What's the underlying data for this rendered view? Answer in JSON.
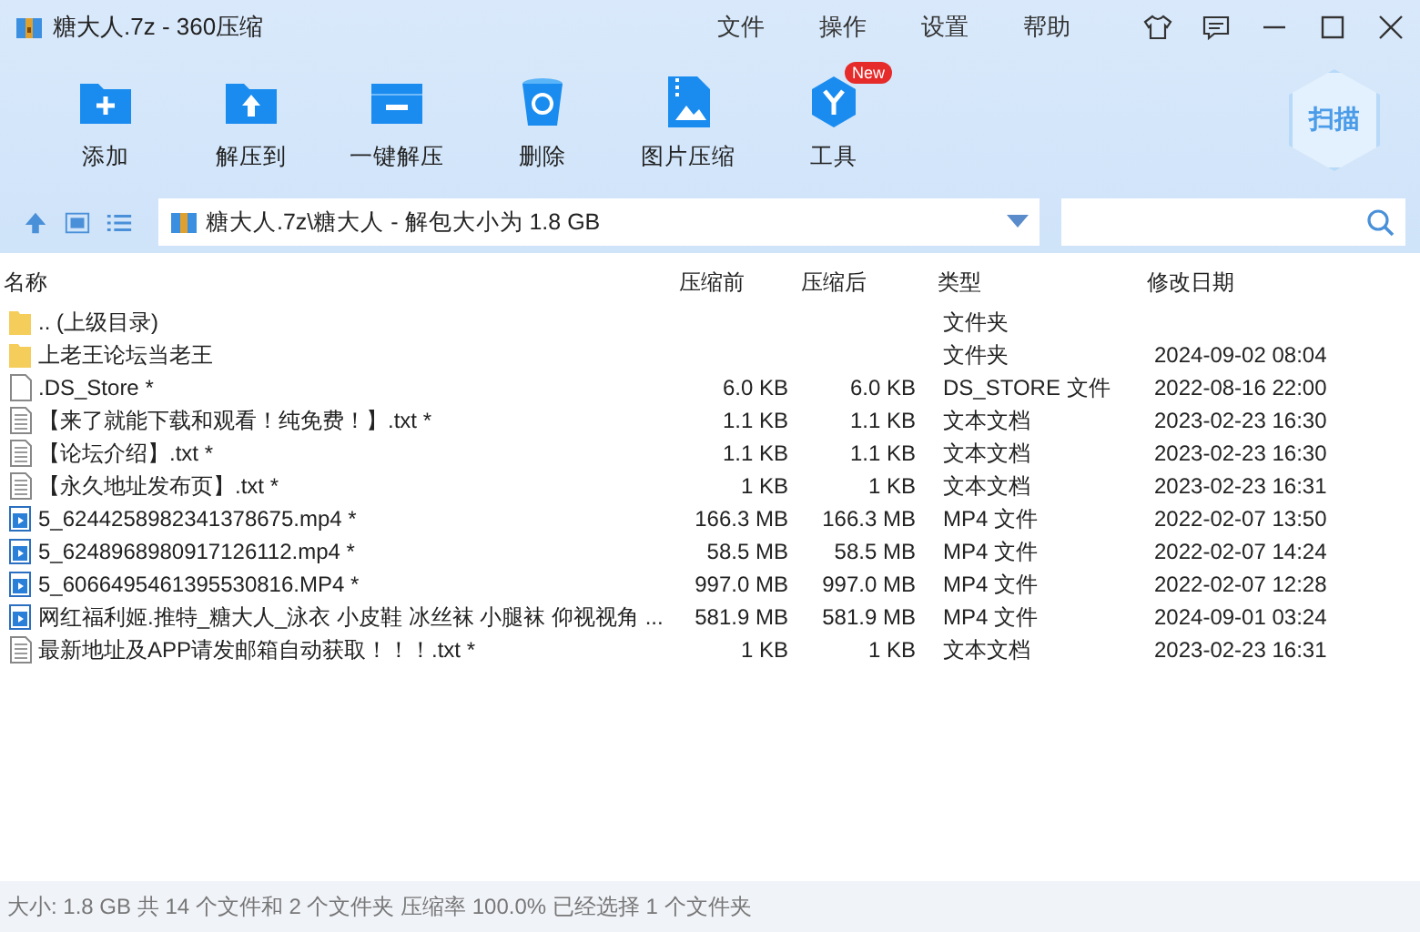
{
  "window": {
    "title": "糖大人.7z - 360压缩"
  },
  "menu": [
    "文件",
    "操作",
    "设置",
    "帮助"
  ],
  "toolbar": [
    {
      "label": "添加",
      "kind": "add"
    },
    {
      "label": "解压到",
      "kind": "extract"
    },
    {
      "label": "一键解压",
      "kind": "oneclick"
    },
    {
      "label": "删除",
      "kind": "delete"
    },
    {
      "label": "图片压缩",
      "kind": "image"
    },
    {
      "label": "工具",
      "kind": "tools",
      "badge": "New"
    }
  ],
  "scan_button": "扫描",
  "address": {
    "path": "糖大人.7z\\糖大人 - 解包大小为 1.8 GB"
  },
  "table": {
    "columns": [
      "名称",
      "压缩前",
      "压缩后",
      "类型",
      "修改日期"
    ],
    "rows": [
      {
        "kind": "folder",
        "name": ".. (上级目录)",
        "before": "",
        "after": "",
        "type": "文件夹",
        "date": ""
      },
      {
        "kind": "folder",
        "name": "上老王论坛当老王",
        "before": "",
        "after": "",
        "type": "文件夹",
        "date": "2024-09-02 08:04"
      },
      {
        "kind": "file",
        "name": ".DS_Store *",
        "before": "6.0 KB",
        "after": "6.0 KB",
        "type": "DS_STORE 文件",
        "date": "2022-08-16 22:00"
      },
      {
        "kind": "text",
        "name": "【来了就能下载和观看！纯免费！】.txt *",
        "before": "1.1 KB",
        "after": "1.1 KB",
        "type": "文本文档",
        "date": "2023-02-23 16:30"
      },
      {
        "kind": "text",
        "name": "【论坛介绍】.txt *",
        "before": "1.1 KB",
        "after": "1.1 KB",
        "type": "文本文档",
        "date": "2023-02-23 16:30"
      },
      {
        "kind": "text",
        "name": "【永久地址发布页】.txt *",
        "before": "1 KB",
        "after": "1 KB",
        "type": "文本文档",
        "date": "2023-02-23 16:31"
      },
      {
        "kind": "video",
        "name": "5_6244258982341378675.mp4 *",
        "before": "166.3 MB",
        "after": "166.3 MB",
        "type": "MP4 文件",
        "date": "2022-02-07 13:50"
      },
      {
        "kind": "video",
        "name": "5_6248968980917126112.mp4 *",
        "before": "58.5 MB",
        "after": "58.5 MB",
        "type": "MP4 文件",
        "date": "2022-02-07 14:24"
      },
      {
        "kind": "video",
        "name": "5_6066495461395530816.MP4 *",
        "before": "997.0 MB",
        "after": "997.0 MB",
        "type": "MP4 文件",
        "date": "2022-02-07 12:28"
      },
      {
        "kind": "video",
        "name": "网红福利姬.推特_糖大人_泳衣 小皮鞋 冰丝袜 小腿袜 仰视视角 ...",
        "before": "581.9 MB",
        "after": "581.9 MB",
        "type": "MP4 文件",
        "date": "2024-09-01 03:24"
      },
      {
        "kind": "text",
        "name": "最新地址及APP请发邮箱自动获取！！！.txt *",
        "before": "1 KB",
        "after": "1 KB",
        "type": "文本文档",
        "date": "2023-02-23 16:31"
      }
    ]
  },
  "status_bar": "大小: 1.8 GB 共 14 个文件和 2 个文件夹 压缩率 100.0% 已经选择 1 个文件夹"
}
